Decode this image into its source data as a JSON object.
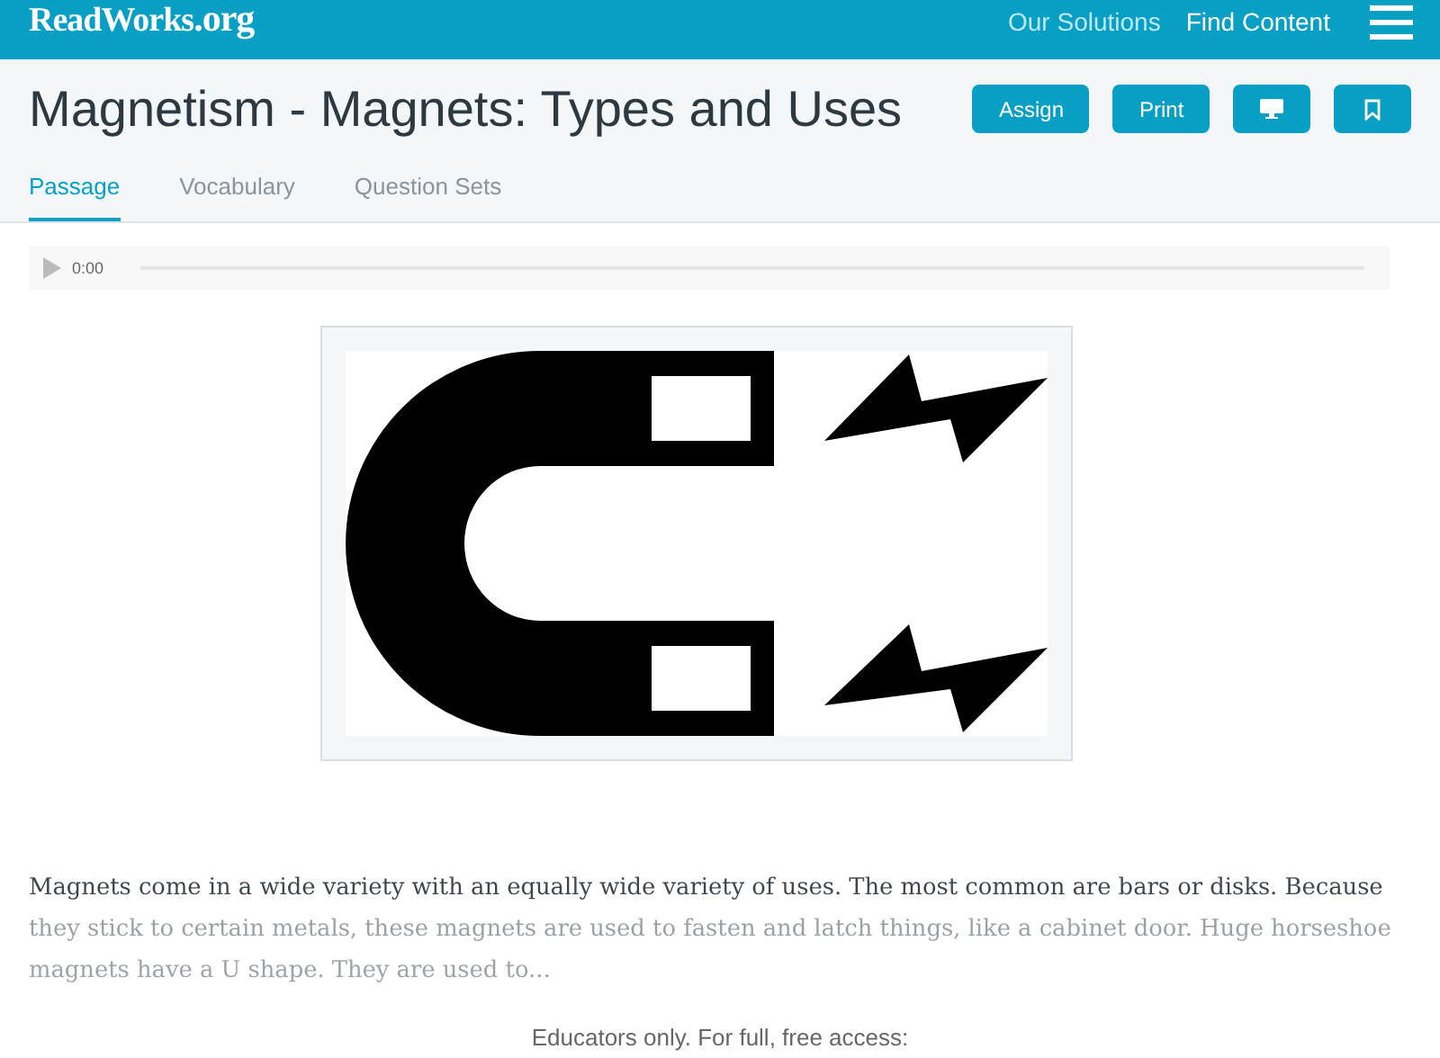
{
  "header": {
    "logo": "ReadWorks",
    "logo_suffix": ".org",
    "nav": [
      "Our Solutions",
      "Find Content"
    ]
  },
  "title": "Magnetism - Magnets: Types and Uses",
  "actions": [
    {
      "kind": "text",
      "label": "Assign"
    },
    {
      "kind": "text",
      "label": "Print"
    },
    {
      "kind": "monitor"
    },
    {
      "kind": "bookmark"
    }
  ],
  "tabs": [
    {
      "label": "Passage",
      "selected": true
    },
    {
      "label": "Vocabulary",
      "selected": false
    },
    {
      "label": "Question Sets",
      "selected": false
    }
  ],
  "audio": {
    "time": "0:00"
  },
  "figure": {
    "kind": "magnet"
  },
  "passage": "Magnets come in a wide variety with an equally wide variety of uses. The most common are bars or disks. Because they stick to certain metals, these magnets are used to fasten and latch things, like a cabinet door. Huge horseshoe magnets have a U shape. They are used to...",
  "access_note": "Educators only. For full, free access:"
}
